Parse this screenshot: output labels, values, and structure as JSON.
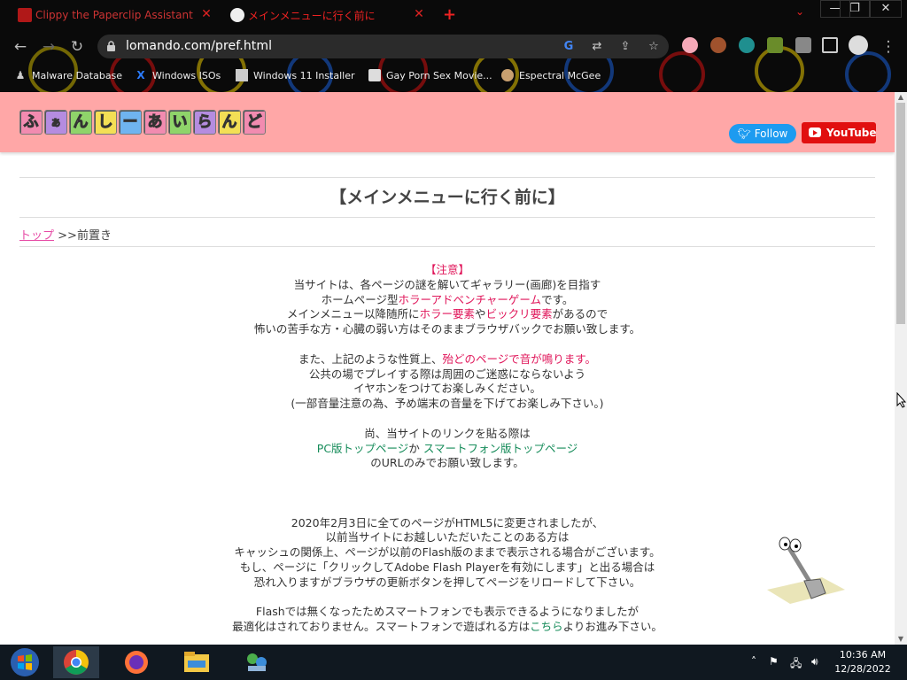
{
  "browser": {
    "tabs": [
      {
        "title": "Clippy the Paperclip Assistant - Pr",
        "close": "✕"
      },
      {
        "title": "メインメニューに行く前に",
        "close": "✕"
      }
    ],
    "new_tab": "+",
    "window_controls": {
      "minimize": "—",
      "restore": "❐",
      "close": "✕"
    },
    "url": "lomando.com/pref.html",
    "bookmarks": [
      {
        "label": "Malware Database",
        "icon": "person-silhouette-icon"
      },
      {
        "label": "Windows ISOs",
        "icon": "x-icon"
      },
      {
        "label": "Windows 11 Installer",
        "icon": "image-icon"
      },
      {
        "label": "Gay Porn Sex Movie...",
        "icon": "site-icon"
      },
      {
        "label": "Espectral McGee",
        "icon": "avatar-icon"
      }
    ]
  },
  "site": {
    "follow_label": "Follow",
    "youtube_label": "YouTube",
    "logo_chars": [
      "ふ",
      "ぁ",
      "ん",
      "し",
      "ー",
      "あ",
      "い",
      "ら",
      "ん",
      "ど"
    ],
    "page_title": "【メインメニューに行く前に】",
    "breadcrumb": {
      "home": "トップ",
      "sep": " >>",
      "current": "前置き"
    },
    "notice": {
      "head_open": "【",
      "head": "注意",
      "head_close": "】",
      "l1": "当サイトは、各ページの謎を解いてギャラリー(画廊)を目指す",
      "l2a": "ホームページ型",
      "l2b": "ホラーアドベンチャーゲーム",
      "l2c": "です。",
      "l3a": "メインメニュー以降随所に",
      "l3b": "ホラー要素",
      "l3c": "や",
      "l3d": "ビックリ要素",
      "l3e": "があるので",
      "l4": "怖いの苦手な方・心臓の弱い方はそのままブラウザバックでお願い致します。",
      "l5a": "また、上記のような性質上、",
      "l5b": "殆どのページで音が鳴ります。",
      "l6": "公共の場でプレイする際は周囲のご迷惑にならないよう",
      "l7": "イヤホンをつけてお楽しみください。",
      "l8": "(一部音量注意の為、予め端末の音量を下げてお楽しみ下さい。)",
      "l9": "尚、当サイトのリンクを貼る際は",
      "l10a": "PC版トップページ",
      "l10b": "か",
      "l10c": "スマートフォン版トップページ",
      "l11": "のURLのみでお願い致します。",
      "l12": "2020年2月3日に全てのページがHTML5に変更されましたが、",
      "l13": "以前当サイトにお越しいただいたことのある方は",
      "l14": "キャッシュの関係上、ページが以前のFlash版のままで表示される場合がございます。",
      "l15": "もし、ページに「クリックしてAdobe Flash Playerを有効にします」と出る場合は",
      "l16": "恐れ入りますがブラウザの更新ボタンを押してページをリロードして下さい。",
      "l17": "Flashでは無くなったためスマートフォンでも表示できるようになりましたが",
      "l18a": "最適化はされておりません。スマートフォンで遊ばれる方は",
      "l18b": "こちら",
      "l18c": "よりお進み下さい。"
    }
  },
  "taskbar": {
    "time": "10:36 AM",
    "date": "12/28/2022",
    "apps": [
      "start-button",
      "chrome-icon",
      "firefox-icon",
      "file-explorer-icon",
      "network-app-icon"
    ]
  },
  "colors": {
    "header_pink": "#ffa7a7",
    "accent_red": "#e0165a",
    "link_green": "#168c5a",
    "crumb_pink": "#e64aa5"
  }
}
